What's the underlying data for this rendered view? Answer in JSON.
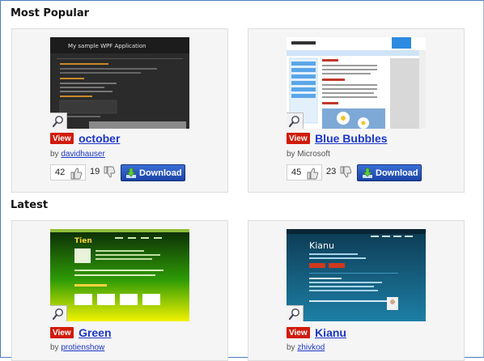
{
  "sections": {
    "popular_title": "Most Popular",
    "latest_title": "Latest"
  },
  "themes": [
    {
      "badge": "View",
      "name": "october",
      "by": "by",
      "author": "davidhauser",
      "likes": "42",
      "dislikes": "19",
      "download": "Download",
      "preview_heading": "My sample WPF Application"
    },
    {
      "badge": "View",
      "name": "Blue Bubbles",
      "by": "by",
      "author": "Microsoft",
      "likes": "45",
      "dislikes": "23",
      "download": "Download"
    },
    {
      "badge": "View",
      "name": "Green",
      "by": "by",
      "author": "protienshow",
      "preview_heading": "Tien"
    },
    {
      "badge": "View",
      "name": "Kianu",
      "by": "by",
      "author": "zhivkod",
      "preview_heading": "Kianu"
    }
  ],
  "colors": {
    "view_badge": "#d11b0b",
    "link": "#1d37c8",
    "download_button": "#2a56c0",
    "frame_border": "#4a7dbd"
  },
  "icons": {
    "zoom": "magnifier-icon",
    "like": "thumbs-up-icon",
    "dislike": "thumbs-down-icon",
    "download": "download-arrow-icon"
  }
}
